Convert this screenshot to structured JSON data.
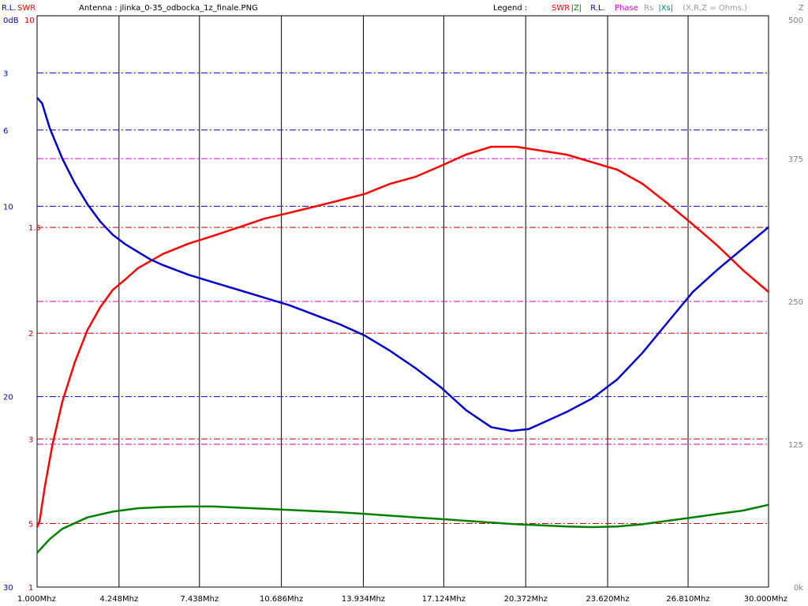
{
  "header": {
    "rl_label": "R.L.",
    "swr_label": "SWR",
    "antenna_text": "Antenna : jlinka_0-35_odbocka_1z_finale.PNG",
    "legend_label": "Legend :",
    "legend_items": [
      {
        "text": "SWR",
        "color": "#ff0000"
      },
      {
        "text": "|Z|",
        "color": "#008000"
      },
      {
        "text": "R.L.",
        "color": "#0000cc"
      },
      {
        "text": "Phase",
        "color": "#cc00cc"
      },
      {
        "text": "Rs",
        "color": "#9a9a9a"
      },
      {
        "text": "|Xs|",
        "color": "#008080"
      },
      {
        "text": "(X,R,Z = Ohms.)",
        "color": "#9a9a9a"
      }
    ],
    "right_unit": "Z"
  },
  "chart_data": {
    "type": "line",
    "x": {
      "min": 1.0,
      "max": 30.0,
      "unit": "MHz",
      "tick_labels": [
        "1.000Mhz",
        "4.248Mhz",
        "7.438Mhz",
        "10.686Mhz",
        "13.934Mhz",
        "17.124Mhz",
        "20.372Mhz",
        "23.620Mhz",
        "26.810Mhz",
        "30.000Mhz"
      ],
      "tick_values": [
        1.0,
        4.248,
        7.438,
        10.686,
        13.934,
        17.124,
        20.372,
        23.62,
        26.81,
        30.0
      ]
    },
    "axes": {
      "rl": {
        "unit_label": "0dB",
        "labels": [
          "3",
          "6",
          "10",
          "20",
          "30"
        ],
        "values": [
          3,
          6,
          10,
          20,
          30
        ],
        "color": "#0000cc",
        "range": [
          0,
          30
        ]
      },
      "swr": {
        "top_label": "10",
        "labels": [
          "5",
          "3",
          "2",
          "1.5",
          "1"
        ],
        "values": [
          5,
          3,
          2,
          1.5,
          1
        ],
        "color": "#cc0000",
        "range": [
          1,
          10
        ]
      },
      "z": {
        "labels": [
          "500",
          "375",
          "250",
          "125",
          "0k"
        ],
        "values": [
          500,
          375,
          250,
          125,
          0
        ],
        "color": "#808080",
        "range": [
          0,
          500
        ]
      }
    },
    "grid": true,
    "series": [
      {
        "name": "SWR",
        "axis": "swr",
        "color": "#ff0000",
        "points": [
          [
            1.0,
            5.15
          ],
          [
            1.1,
            4.9
          ],
          [
            1.3,
            3.9
          ],
          [
            1.6,
            3.1
          ],
          [
            2.0,
            2.55
          ],
          [
            2.5,
            2.2
          ],
          [
            3.0,
            1.98
          ],
          [
            3.5,
            1.85
          ],
          [
            4.0,
            1.76
          ],
          [
            4.5,
            1.71
          ],
          [
            5.0,
            1.66
          ],
          [
            6.0,
            1.6
          ],
          [
            7.0,
            1.56
          ],
          [
            8.0,
            1.53
          ],
          [
            9.0,
            1.5
          ],
          [
            10.0,
            1.47
          ],
          [
            11.0,
            1.45
          ],
          [
            12.0,
            1.43
          ],
          [
            13.0,
            1.41
          ],
          [
            14.0,
            1.39
          ],
          [
            15.0,
            1.36
          ],
          [
            16.0,
            1.34
          ],
          [
            17.0,
            1.31
          ],
          [
            18.0,
            1.28
          ],
          [
            19.0,
            1.26
          ],
          [
            20.0,
            1.26
          ],
          [
            21.0,
            1.27
          ],
          [
            22.0,
            1.28
          ],
          [
            23.0,
            1.3
          ],
          [
            24.0,
            1.32
          ],
          [
            25.0,
            1.36
          ],
          [
            26.0,
            1.42
          ],
          [
            27.0,
            1.49
          ],
          [
            28.0,
            1.57
          ],
          [
            29.0,
            1.67
          ],
          [
            30.0,
            1.77
          ]
        ]
      },
      {
        "name": "|Z|",
        "axis": "z",
        "color": "#008000",
        "points": [
          [
            1.0,
            30
          ],
          [
            1.5,
            42
          ],
          [
            2.0,
            51
          ],
          [
            3.0,
            61
          ],
          [
            4.0,
            66
          ],
          [
            5.0,
            69
          ],
          [
            6.0,
            70
          ],
          [
            7.0,
            70.5
          ],
          [
            8.0,
            70.5
          ],
          [
            9.0,
            69.5
          ],
          [
            10.0,
            68.5
          ],
          [
            11.0,
            67.5
          ],
          [
            12.0,
            66.5
          ],
          [
            13.0,
            65.5
          ],
          [
            14.0,
            64
          ],
          [
            15.0,
            62.5
          ],
          [
            16.0,
            61
          ],
          [
            17.0,
            59.5
          ],
          [
            18.0,
            58
          ],
          [
            19.0,
            56.5
          ],
          [
            20.0,
            55
          ],
          [
            21.0,
            54
          ],
          [
            22.0,
            53
          ],
          [
            23.0,
            52.5
          ],
          [
            24.0,
            53
          ],
          [
            25.0,
            55
          ],
          [
            26.0,
            58
          ],
          [
            27.0,
            61
          ],
          [
            28.0,
            64
          ],
          [
            29.0,
            67
          ],
          [
            30.0,
            72
          ]
        ]
      },
      {
        "name": "R.L.",
        "axis": "rl",
        "color": "#0000cc",
        "points": [
          [
            1.0,
            4.3
          ],
          [
            1.2,
            4.6
          ],
          [
            1.5,
            5.9
          ],
          [
            2.0,
            7.5
          ],
          [
            2.5,
            8.8
          ],
          [
            3.0,
            9.9
          ],
          [
            3.5,
            10.8
          ],
          [
            4.0,
            11.5
          ],
          [
            4.5,
            12.0
          ],
          [
            5.0,
            12.4
          ],
          [
            5.5,
            12.8
          ],
          [
            6.0,
            13.1
          ],
          [
            7.0,
            13.6
          ],
          [
            8.0,
            14.0
          ],
          [
            9.0,
            14.4
          ],
          [
            10.0,
            14.8
          ],
          [
            11.0,
            15.2
          ],
          [
            12.0,
            15.7
          ],
          [
            13.0,
            16.2
          ],
          [
            14.0,
            16.8
          ],
          [
            15.0,
            17.6
          ],
          [
            16.0,
            18.5
          ],
          [
            17.0,
            19.5
          ],
          [
            18.0,
            20.7
          ],
          [
            19.0,
            21.6
          ],
          [
            19.8,
            21.8
          ],
          [
            20.5,
            21.7
          ],
          [
            21.0,
            21.4
          ],
          [
            22.0,
            20.8
          ],
          [
            23.0,
            20.1
          ],
          [
            24.0,
            19.1
          ],
          [
            25.0,
            17.7
          ],
          [
            26.0,
            16.1
          ],
          [
            27.0,
            14.5
          ],
          [
            28.0,
            13.3
          ],
          [
            29.0,
            12.2
          ],
          [
            30.0,
            11.1
          ]
        ]
      }
    ]
  }
}
